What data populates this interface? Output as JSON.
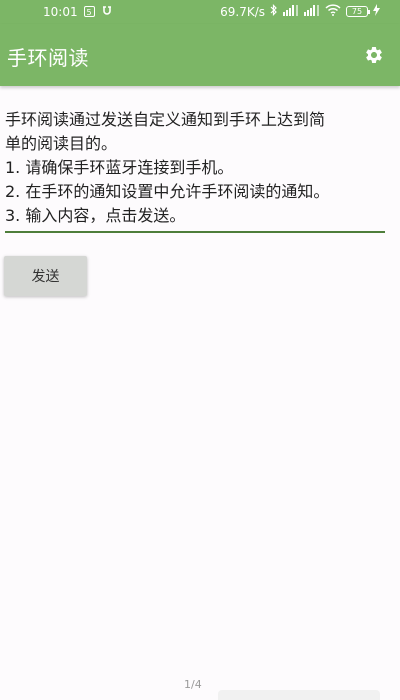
{
  "status_bar": {
    "time": "10:01",
    "network_speed": "69.7K/s",
    "battery_level": "75",
    "icons": [
      "notification-icon",
      "sync-icon",
      "bluetooth-icon",
      "signal-icon",
      "wifi-icon",
      "battery-icon",
      "charging-icon"
    ]
  },
  "app_bar": {
    "title": "手环阅读",
    "settings_icon": "gear-icon",
    "color": "#7cb666"
  },
  "main": {
    "intro_lines": [
      "手环阅读通过发送自定义通知到手环上达到简",
      "单的阅读目的。",
      "1. 请确保手环蓝牙连接到手机。",
      "2. 在手环的通知设置中允许手环阅读的通知。"
    ],
    "input_value": "3. 输入内容，点击发送。",
    "send_label": "发送"
  },
  "footer": {
    "page_indicator": "1/4"
  }
}
